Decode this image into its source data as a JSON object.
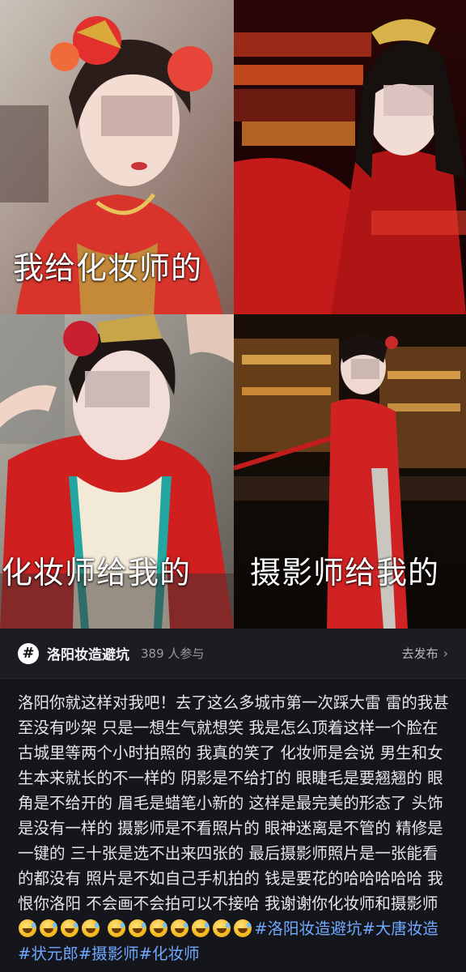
{
  "photos": [
    {
      "caption": "我给化妆师的"
    },
    {
      "caption": ""
    },
    {
      "caption": "化妆师给我的"
    },
    {
      "caption": "摄影师给我的"
    }
  ],
  "topic": {
    "icon": "#",
    "name": "洛阳妆造避坑",
    "participants": "389 人参与",
    "action": "去发布"
  },
  "post": {
    "text": "洛阳你就这样对我吧！去了这么多城市第一次踩大雷 雷的我甚至没有吵架 只是一想生气就想笑 我是怎么顶着这样一个脸在古城里等两个小时拍照的 我真的笑了 化妆师是会说 男生和女生本来就长的不一样的 阴影是不给打的 眼睫毛是要翘翘的 眼角是不给开的 眉毛是蜡笔小新的 这样是最完美的形态了 头饰是没有一样的 摄影师是不看照片的 眼神迷离是不管的 精修是一键的 三十张是选不出来四张的 最后摄影师照片是一张能看的都没有 照片是不如自己手机拍的 钱是要花的哈哈哈哈哈 我恨你洛阳 不会画不会拍可以不接哈 我谢谢你化妆师和摄影师",
    "emoji_count": 11,
    "emoji_name": "sweat-smile-emoji",
    "hashtags": [
      "#洛阳妆造避坑",
      "#大唐妆造",
      "#状元郎",
      "#摄影师",
      "#化妆师"
    ]
  },
  "colors": {
    "background": "#15161b",
    "hashtag": "#6ea8ff"
  }
}
